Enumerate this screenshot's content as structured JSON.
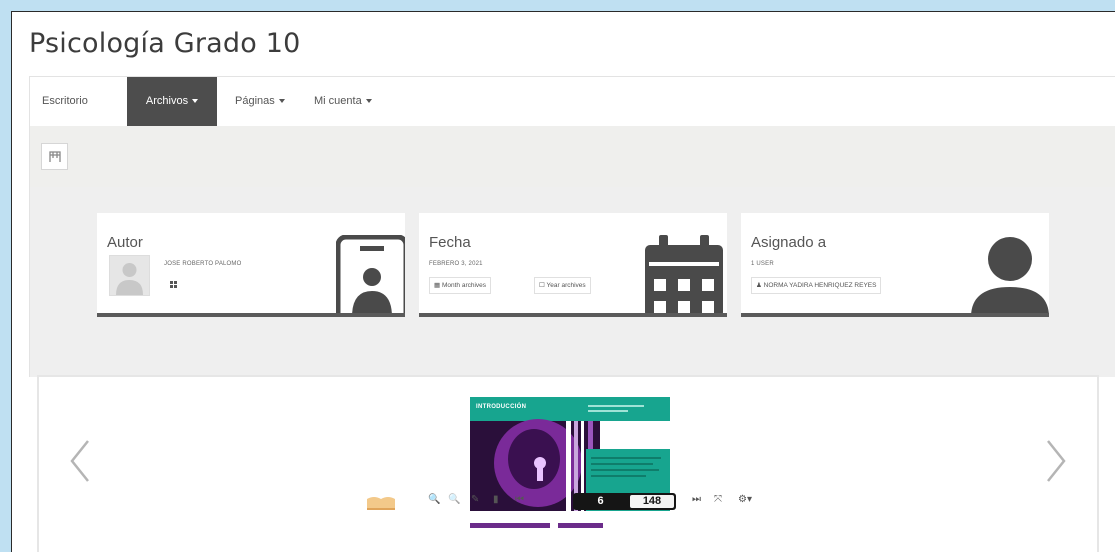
{
  "page": {
    "title": "Psicología Grado 10"
  },
  "nav": {
    "items": [
      {
        "label": "Escritorio"
      },
      {
        "label": "Archivos"
      },
      {
        "label": "Páginas"
      },
      {
        "label": "Mi cuenta"
      }
    ],
    "active": "Archivos"
  },
  "cards": {
    "autor": {
      "label": "Autor",
      "name": "JOSE ROBERTO PALOMO"
    },
    "fecha": {
      "label": "Fecha",
      "date": "FEBRERO 3, 2021",
      "month_archives": "Month archives",
      "year_archives": "Year archives"
    },
    "asignado": {
      "label": "Asignado a",
      "count": "1 USER",
      "user": "NORMA YADIRA HENRIQUEZ REYES"
    }
  },
  "flipbook": {
    "cover_title": "INTRODUCCIÓN",
    "current_page": "6",
    "total_pages": "148"
  },
  "colors": {
    "nav_active": "#4d4d4d",
    "cover_teal": "#17a58f",
    "cover_purple": "#6b2c8a"
  }
}
